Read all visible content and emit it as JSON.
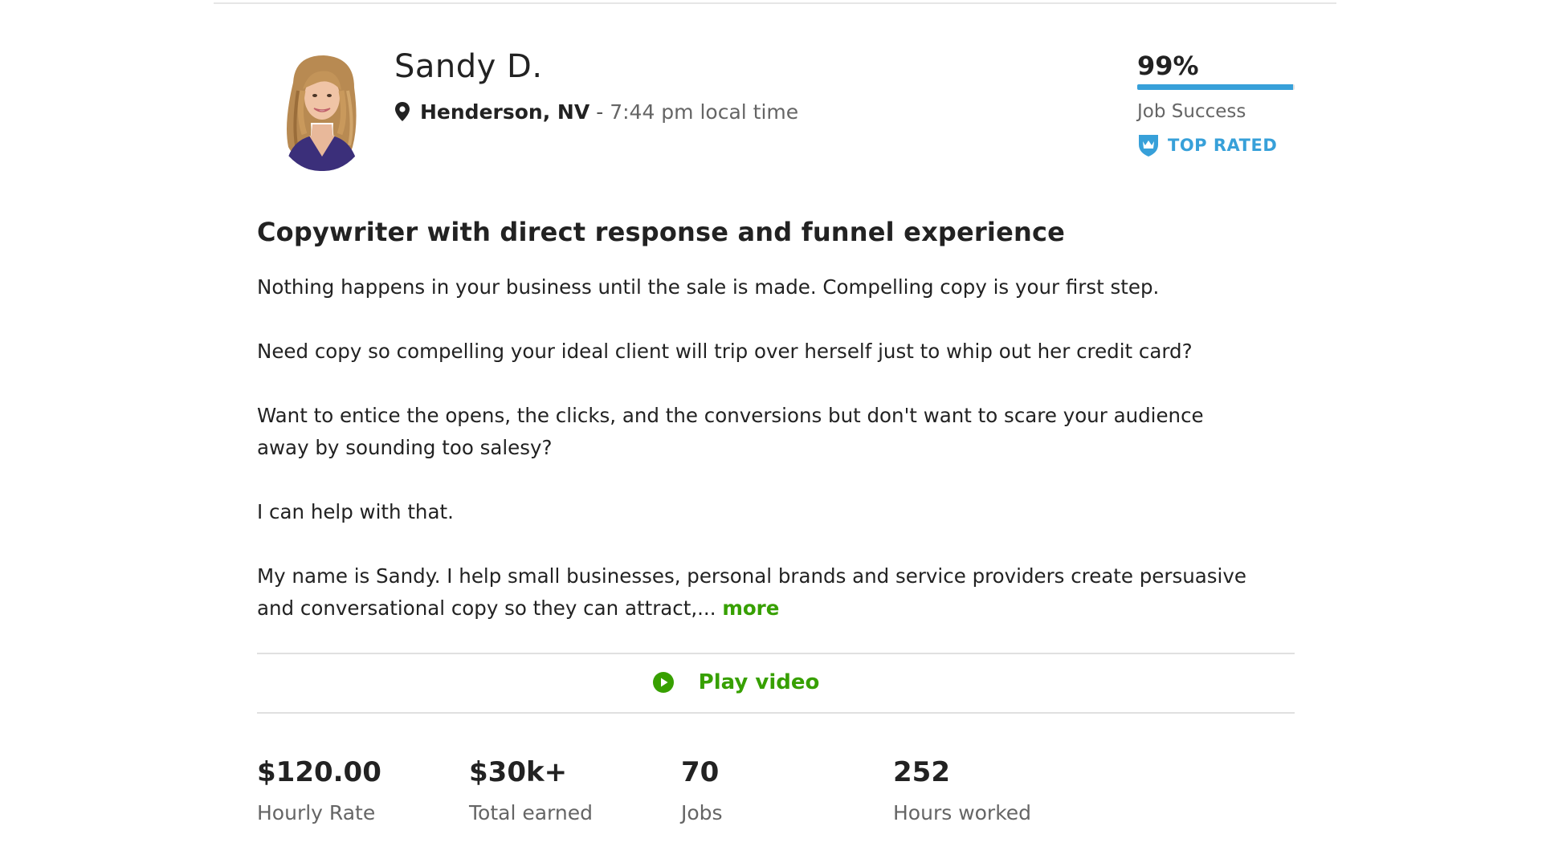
{
  "profile": {
    "name": "Sandy D.",
    "location_city": "Henderson, NV",
    "location_separator": "-",
    "local_time": "7:44 pm local time"
  },
  "job_success": {
    "value": "99%",
    "fraction": 0.99,
    "label": "Job Success",
    "badge": "TOP RATED"
  },
  "overview": {
    "title": "Copywriter with direct response and funnel experience",
    "paragraphs": [
      "Nothing happens in your business until the sale is made. Compelling copy is your first step.",
      "Need copy so compelling your ideal client will trip over herself just to whip out her credit card?",
      "Want to entice the opens, the clicks, and the conversions but don't want to scare your audience",
      "away by sounding too salesy?",
      "I can help with that.",
      "My name is Sandy. I help small businesses, personal brands and service providers create persuasive",
      "and conversational copy so they can attract,..."
    ],
    "more_label": "more"
  },
  "video": {
    "label": "Play video"
  },
  "stats": [
    {
      "value": "$120.00",
      "label": "Hourly Rate"
    },
    {
      "value": "$30k+",
      "label": "Total earned"
    },
    {
      "value": "70",
      "label": "Jobs"
    },
    {
      "value": "252",
      "label": "Hours worked"
    }
  ],
  "colors": {
    "accent_green": "#37a000",
    "accent_blue": "#37a0d9",
    "text_primary": "#222222",
    "text_muted": "#656565",
    "divider": "#e0e0e0"
  },
  "icons": {
    "location": "map-pin-icon",
    "badge": "shield-crown-icon",
    "play": "play-circle-icon"
  }
}
